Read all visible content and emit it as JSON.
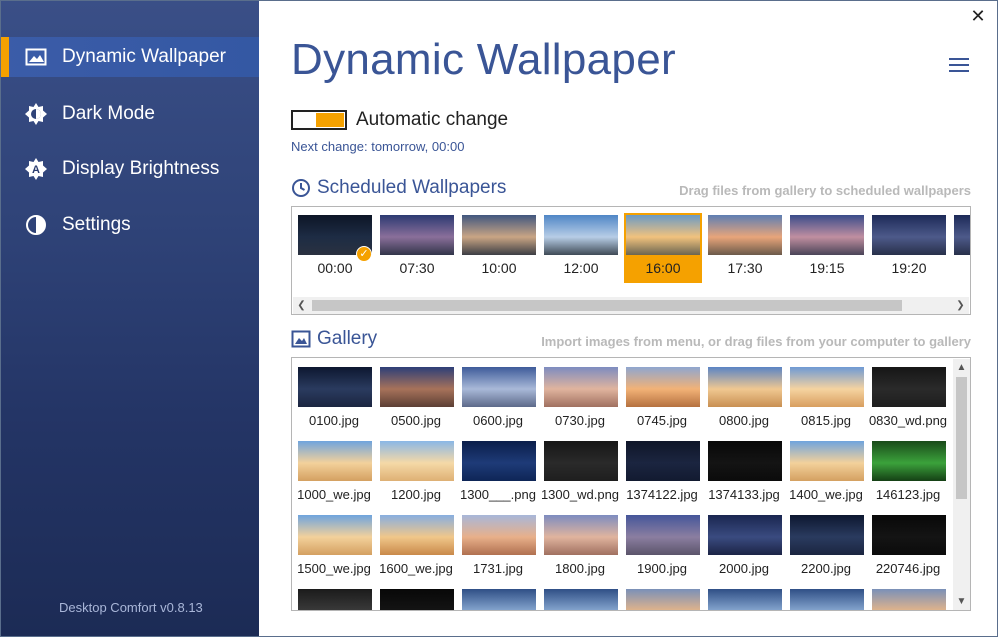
{
  "sidebar": {
    "items": [
      {
        "label": "Dynamic Wallpaper",
        "icon": "image-icon",
        "active": true
      },
      {
        "label": "Dark Mode",
        "icon": "dark-mode-icon",
        "active": false
      },
      {
        "label": "Display Brightness",
        "icon": "brightness-icon",
        "active": false
      },
      {
        "label": "Settings",
        "icon": "contrast-icon",
        "active": false
      }
    ],
    "version": "Desktop Comfort v0.8.13"
  },
  "window": {
    "close_label": "✕"
  },
  "main": {
    "title": "Dynamic Wallpaper",
    "automatic_change": {
      "label": "Automatic change",
      "enabled": true
    },
    "next_change": "Next change: tomorrow, 00:00"
  },
  "scheduled": {
    "title": "Scheduled Wallpapers",
    "hint": "Drag files from gallery to scheduled wallpapers",
    "items": [
      {
        "time": "00:00",
        "tone": "night",
        "active_check": true
      },
      {
        "time": "07:30",
        "tone": "dawn"
      },
      {
        "time": "10:00",
        "tone": "morning"
      },
      {
        "time": "12:00",
        "tone": "noon"
      },
      {
        "time": "16:00",
        "tone": "afternoon",
        "selected": true
      },
      {
        "time": "17:30",
        "tone": "evening"
      },
      {
        "time": "19:15",
        "tone": "dusk"
      },
      {
        "time": "19:20",
        "tone": "twilight"
      }
    ]
  },
  "gallery": {
    "title": "Gallery",
    "hint": "Import images from menu, or drag files from your computer to gallery",
    "items": [
      {
        "name": "0100.jpg",
        "tone": "dune-night"
      },
      {
        "name": "0500.jpg",
        "tone": "dune-dawn"
      },
      {
        "name": "0600.jpg",
        "tone": "dune-blue"
      },
      {
        "name": "0730.jpg",
        "tone": "dune-pink"
      },
      {
        "name": "0745.jpg",
        "tone": "dune-warm"
      },
      {
        "name": "0800.jpg",
        "tone": "dune-morning"
      },
      {
        "name": "0815.jpg",
        "tone": "dune-light"
      },
      {
        "name": "0830_wd.png",
        "tone": "dark-wood"
      },
      {
        "name": "1000_we.jpg",
        "tone": "dune-day"
      },
      {
        "name": "1200.jpg",
        "tone": "dune-noon"
      },
      {
        "name": "1300___.png",
        "tone": "tech-blue"
      },
      {
        "name": "1300_wd.png",
        "tone": "dark-wood"
      },
      {
        "name": "1374122.jpg",
        "tone": "dark-navy"
      },
      {
        "name": "1374133.jpg",
        "tone": "dark-black"
      },
      {
        "name": "1400_we.jpg",
        "tone": "dune-day"
      },
      {
        "name": "146123.jpg",
        "tone": "green-screen"
      },
      {
        "name": "1500_we.jpg",
        "tone": "dune-day"
      },
      {
        "name": "1600_we.jpg",
        "tone": "dune-afternoon"
      },
      {
        "name": "1731.jpg",
        "tone": "dune-sunset"
      },
      {
        "name": "1800.jpg",
        "tone": "dune-pink"
      },
      {
        "name": "1900.jpg",
        "tone": "dune-dusk"
      },
      {
        "name": "2000.jpg",
        "tone": "dune-blue-night"
      },
      {
        "name": "2200.jpg",
        "tone": "dune-night"
      },
      {
        "name": "220746.jpg",
        "tone": "dark-black"
      },
      {
        "name": "",
        "tone": "dark-gray"
      },
      {
        "name": "",
        "tone": "dark-black"
      },
      {
        "name": "",
        "tone": "island-blue"
      },
      {
        "name": "",
        "tone": "island-blue"
      },
      {
        "name": "",
        "tone": "island-warm"
      },
      {
        "name": "",
        "tone": "island-blue"
      },
      {
        "name": "",
        "tone": "island-blue"
      },
      {
        "name": "",
        "tone": "island-warm"
      }
    ]
  },
  "colors": {
    "accent": "#f5a100",
    "title_blue": "#3a5596",
    "sidebar_top": "#3a4f87",
    "sidebar_bottom": "#1c2b55"
  }
}
